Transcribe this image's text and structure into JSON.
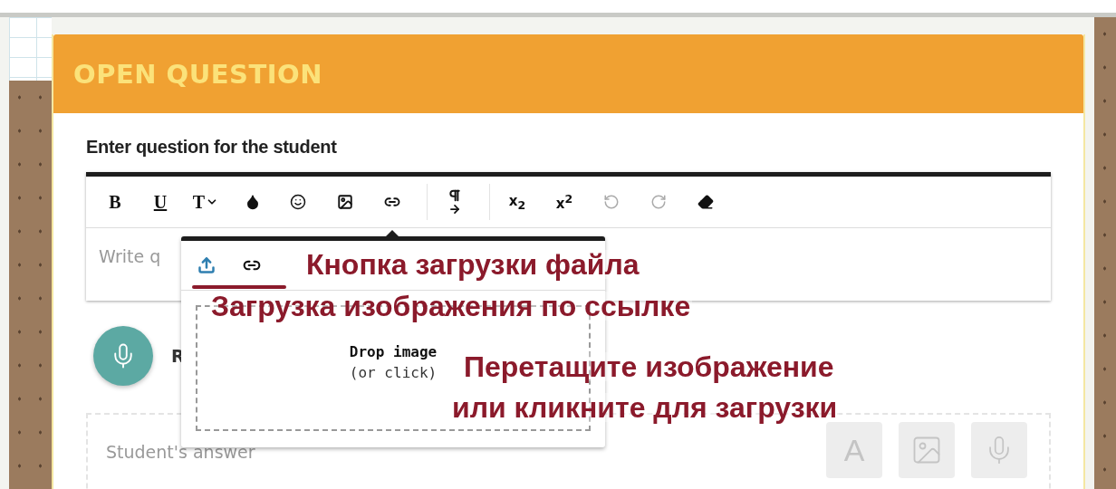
{
  "card": {
    "title": "OPEN QUESTION"
  },
  "question": {
    "label": "Enter question for the student",
    "toolbar": [
      {
        "kind": "bold",
        "label": "B",
        "disabled": false
      },
      {
        "kind": "underline",
        "label": "U",
        "disabled": false
      },
      {
        "kind": "size",
        "label": "T",
        "disabled": false
      },
      {
        "kind": "color",
        "disabled": false
      },
      {
        "kind": "emoji",
        "disabled": false
      },
      {
        "kind": "image",
        "disabled": false
      },
      {
        "kind": "link",
        "disabled": false
      },
      {
        "kind": "separator"
      },
      {
        "kind": "paragraph",
        "disabled": false
      },
      {
        "kind": "separator"
      },
      {
        "kind": "subscript",
        "label": "x$_{2}$",
        "disabled": false
      },
      {
        "kind": "superscript",
        "label": "x$^{2}$",
        "disabled": false
      },
      {
        "kind": "undo",
        "disabled": true
      },
      {
        "kind": "redo",
        "disabled": true
      },
      {
        "kind": "eraser",
        "disabled": false
      }
    ],
    "placeholder": "Write q"
  },
  "image_popup": {
    "tabs": [
      {
        "kind": "upload",
        "selected": true
      },
      {
        "kind": "link",
        "selected": false
      }
    ],
    "drop_title": "Drop image",
    "drop_hint": "(or click)"
  },
  "record": {
    "label": "R"
  },
  "answer": {
    "placeholder": "Student's answer",
    "buttons": [
      {
        "kind": "text",
        "label": "A"
      },
      {
        "kind": "image"
      },
      {
        "kind": "mic"
      }
    ]
  },
  "annotations": [
    {
      "text": "Кнопка загрузки файла"
    },
    {
      "text": "Загрузка изображения по ссылке"
    },
    {
      "text": "Перетащите изображение"
    },
    {
      "text": "или кликните для загрузки"
    }
  ]
}
